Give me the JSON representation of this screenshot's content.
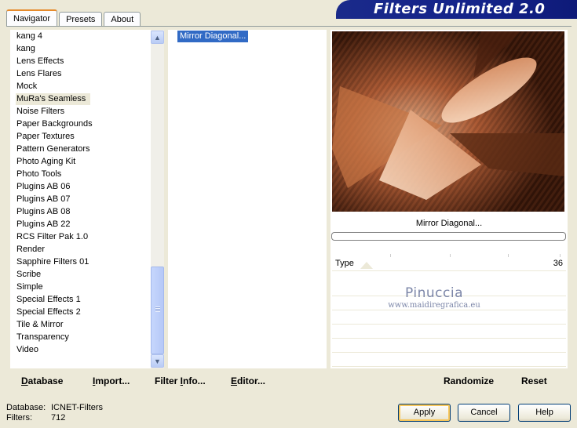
{
  "banner": {
    "title": "Filters Unlimited 2.0"
  },
  "tabs": [
    {
      "label": "Navigator",
      "active": true
    },
    {
      "label": "Presets",
      "active": false
    },
    {
      "label": "About",
      "active": false
    }
  ],
  "categories": {
    "items": [
      "kang 4",
      "kang",
      "Lens Effects",
      "Lens Flares",
      "Mock",
      "MuRa's Seamless",
      "Noise Filters",
      "Paper Backgrounds",
      "Paper Textures",
      "Pattern Generators",
      "Photo Aging Kit",
      "Photo Tools",
      "Plugins AB 06",
      "Plugins AB 07",
      "Plugins AB 08",
      "Plugins AB 22",
      "RCS Filter Pak 1.0",
      "Render",
      "Sapphire Filters 01",
      "Scribe",
      "Simple",
      "Special Effects 1",
      "Special Effects 2",
      "Tile & Mirror",
      "Transparency",
      "Video"
    ],
    "selected_index": 5
  },
  "filters": {
    "items": [
      "Mirror Diagonal..."
    ],
    "selected_index": 0
  },
  "preview": {
    "caption": "Mirror Diagonal...",
    "progress": 0
  },
  "parameters": [
    {
      "label": "Type",
      "value": "36"
    }
  ],
  "watermark": {
    "title": "Pinuccia",
    "url": "www.maidiregrafica.eu"
  },
  "commands_left": [
    {
      "label": "Database",
      "underline_index": 0
    },
    {
      "label": "Import...",
      "underline_index": 0
    },
    {
      "label": "Filter Info...",
      "underline_index": 7
    },
    {
      "label": "Editor...",
      "underline_index": 0
    }
  ],
  "commands_right": [
    {
      "label": "Randomize"
    },
    {
      "label": "Reset"
    }
  ],
  "status": {
    "database_label": "Database:",
    "database_value": "ICNET-Filters",
    "filters_label": "Filters:",
    "filters_value": "712"
  },
  "buttons": {
    "apply": "Apply",
    "cancel": "Cancel",
    "help": "Help"
  },
  "icons": {
    "scroll_up": "chevron-up-icon",
    "scroll_down": "chevron-down-icon"
  }
}
